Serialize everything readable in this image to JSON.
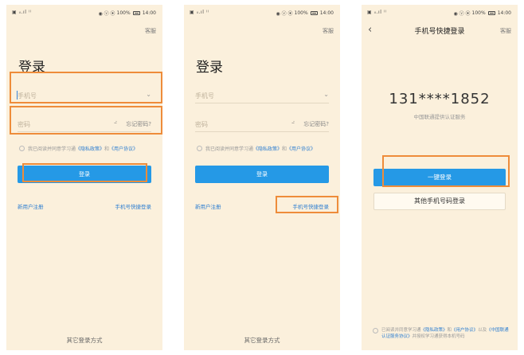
{
  "status_bar": {
    "left": "▣ ᵢₗ.ıl ⁽⁾",
    "icons": "◉ ⓥ ⦿",
    "battery_pct": "100%",
    "time": "14:00"
  },
  "header": {
    "service": "客服"
  },
  "login": {
    "title": "登录",
    "phone_placeholder": "手机号",
    "password_placeholder": "密码",
    "forgot_password": "忘记密码?",
    "agreement_prefix": "我已阅读并同意学习通",
    "privacy_policy": "《隐私政策》",
    "and": "和",
    "user_agreement": "《用户协议》",
    "login_button": "登录",
    "new_user_register": "新用户注册",
    "quick_login": "手机号快捷登录",
    "other_methods": "其它登录方式"
  },
  "quick": {
    "title": "手机号快捷登录",
    "phone_number": "131****1852",
    "carrier_note": "中国联通提供认证服务",
    "one_click_button": "一键登录",
    "other_phone_button": "其他手机号码登录",
    "agree_text_1": "已阅读并同意学习通",
    "privacy_policy": "《隐私政策》",
    "and": "和",
    "user_agreement": "《用户协议》",
    "agree_text_2": "以及",
    "carrier_agreement": "《中国联通认证服务协议》",
    "agree_text_3": "并授权学习通获得本机号码"
  },
  "icons": {
    "back": "chevron-left-icon",
    "dropdown": "chevron-down-icon",
    "eye": "eye-closed-icon"
  },
  "colors": {
    "background": "#fbf0dc",
    "primary_button": "#2599e6",
    "link": "#2f7fd1",
    "highlight": "#ee8c3a"
  }
}
